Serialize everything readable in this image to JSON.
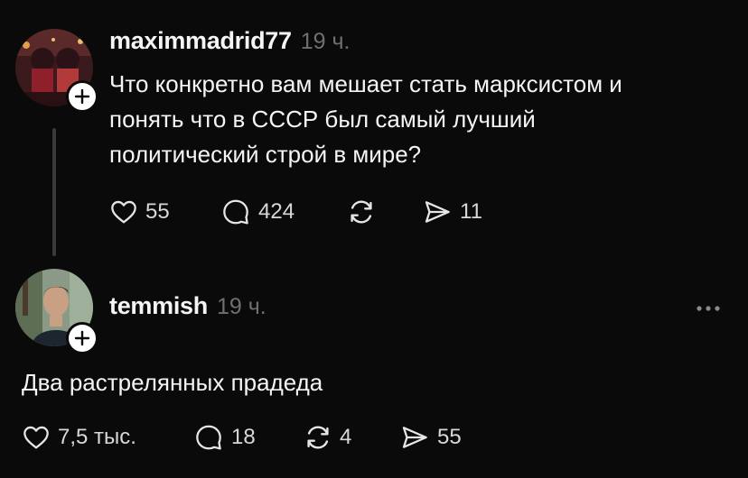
{
  "posts": [
    {
      "username": "maximmadrid77",
      "time": "19 ч.",
      "text_lines": [
        "Что конкретно вам мешает стать марксистом и",
        "понять что в СССР был самый лучший",
        "политический строй в мире?"
      ],
      "likes": "55",
      "replies": "424",
      "reposts": "",
      "shares": "11"
    },
    {
      "username": "temmish",
      "time": "19 ч.",
      "text": "Два растрелянных прадеда",
      "likes": "7,5 тыс.",
      "replies": "18",
      "reposts": "4",
      "shares": "55"
    }
  ],
  "icons": {
    "like": "heart-icon",
    "reply": "comment-bubble-icon",
    "repost": "repost-icon",
    "share": "send-icon",
    "follow": "plus-icon",
    "more": "more-horizontal-icon"
  },
  "colors": {
    "background": "#0a0a0a",
    "text": "#f3f5f7",
    "muted": "#6f6f6f"
  }
}
